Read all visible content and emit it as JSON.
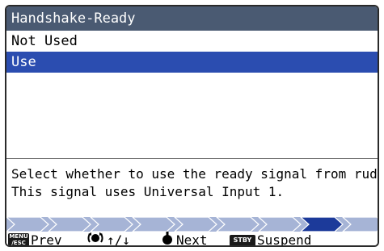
{
  "title": "Handshake-Ready",
  "options": [
    {
      "label": "Not Used",
      "selected": false
    },
    {
      "label": "Use",
      "selected": true
    }
  ],
  "help_lines": [
    "Select whether to use the ready signal from rudder.",
    "This signal uses Universal Input 1."
  ],
  "progress": {
    "steps": 9,
    "current": 8
  },
  "footer": {
    "menu_key_top": "MENU",
    "menu_key_bottom": "/ESC",
    "prev_label": "Prev",
    "arrows_label": "↑/↓",
    "next_label": "Next",
    "stby_key": "STBY",
    "suspend_label": "Suspend"
  },
  "colors": {
    "title_bar": "#4a5a72",
    "selected_row": "#2b4db0",
    "progress_bg": "#a6b4d6",
    "progress_current": "#1c3a9a"
  }
}
